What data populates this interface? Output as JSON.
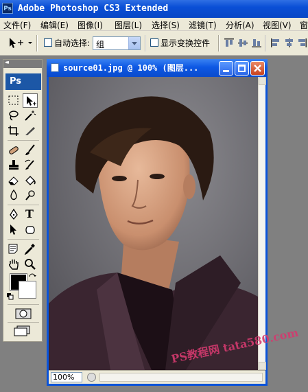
{
  "app": {
    "logo": "Ps",
    "title": "Adobe Photoshop CS3 Extended"
  },
  "menu": [
    {
      "label": "文件(F)"
    },
    {
      "label": "编辑(E)"
    },
    {
      "label": "图像(I)"
    },
    {
      "label": "图层(L)"
    },
    {
      "label": "选择(S)"
    },
    {
      "label": "滤镜(T)"
    },
    {
      "label": "分析(A)"
    },
    {
      "label": "视图(V)"
    },
    {
      "label": "窗"
    }
  ],
  "options": {
    "auto_select_label": "自动选择:",
    "auto_select_checked": false,
    "auto_select_value": "组",
    "show_transform_label": "显示变换控件",
    "show_transform_checked": false
  },
  "toolbox": {
    "logo": "Ps",
    "type_tool_glyph": "T",
    "foreground_color": "#000000",
    "background_color": "#ffffff"
  },
  "document": {
    "title": "source01.jpg @ 100% (图层...",
    "zoom": "100%"
  },
  "watermark": "PS教程网 tata580.com"
}
